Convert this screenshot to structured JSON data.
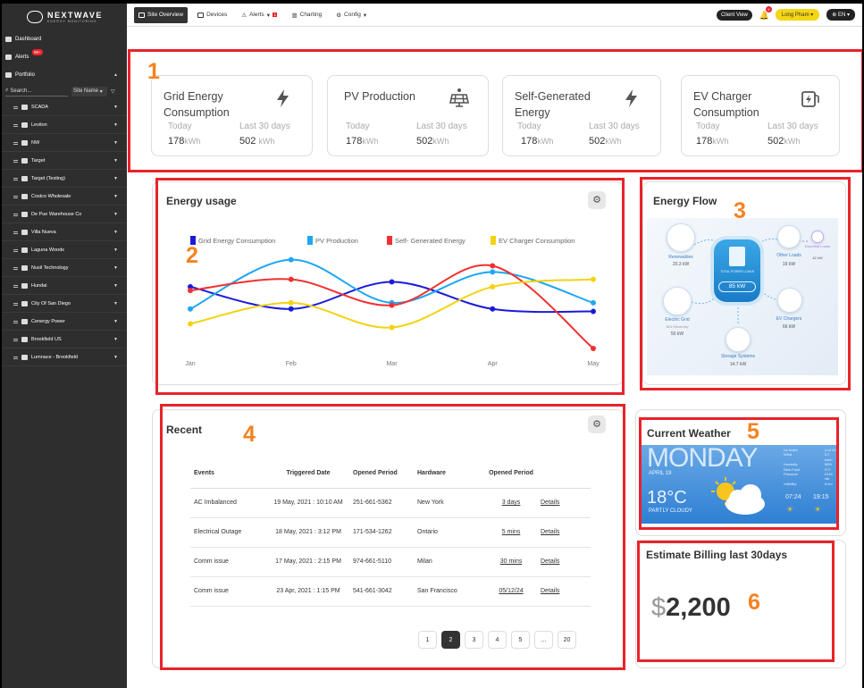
{
  "brand": {
    "name": "NEXTWAVE",
    "tagline": "ENERGY MONITORING"
  },
  "sidebar": {
    "nav": [
      {
        "label": "Dashboard",
        "icon": "dashboard-icon"
      },
      {
        "label": "Alerts",
        "badge": "99+",
        "icon": "alert-icon"
      },
      {
        "label": "Portfolio",
        "icon": "portfolio-icon"
      }
    ],
    "search_placeholder": "Search...",
    "sort_label": "Site Name",
    "sites": [
      "SCADA",
      "Leviton",
      "NW",
      "Target",
      "Target (Testing)",
      "Costco Wholesale",
      "De Pue Warehouse Co",
      "Villa Nueva",
      "Laguna Woods",
      "Nusil Technology",
      "Hundai",
      "City Of San Diego",
      "Cenergy Power",
      "Brookfield US",
      "Lumnace - Brookfield"
    ]
  },
  "topbar": {
    "tabs": [
      {
        "label": "Site Overview"
      },
      {
        "label": "Devices"
      },
      {
        "label": "Alerts",
        "badge": "1"
      },
      {
        "label": "Charting"
      },
      {
        "label": "Config"
      }
    ],
    "client_view": "Client View",
    "bell_badge": "5",
    "user": "Long Pham",
    "language": "EN"
  },
  "stats": [
    {
      "title": "Grid Energy Consumption",
      "icon": "lightning-icon",
      "today_label": "Today",
      "today": "178",
      "last_label": "Last 30 days",
      "last": "502",
      "unit": "kWh"
    },
    {
      "title": "PV Production",
      "icon": "solar-panel-icon",
      "today_label": "Today",
      "today": "178",
      "last_label": "Last 30 days",
      "last": "502",
      "unit": "kWh"
    },
    {
      "title": "Self-Generated Energy",
      "icon": "lightning-icon",
      "today_label": "Today",
      "today": "178",
      "last_label": "Last 30 days",
      "last": "502",
      "unit": "kWh"
    },
    {
      "title": "EV Charger Consumption",
      "icon": "ev-charger-icon",
      "today_label": "Today",
      "today": "178",
      "last_label": "Last 30 days",
      "last": "502",
      "unit": "kWh"
    }
  ],
  "energy_usage": {
    "title": "Energy usage"
  },
  "chart_data": {
    "type": "line",
    "x": [
      "Jan",
      "Feb",
      "Mar",
      "Apr",
      "May"
    ],
    "series": [
      {
        "name": "Grid Energy Consumption",
        "color": "#1a1adb",
        "values": [
          58,
          40,
          62,
          40,
          38
        ]
      },
      {
        "name": "PV Production",
        "color": "#1ea7f2",
        "values": [
          40,
          80,
          45,
          70,
          45
        ]
      },
      {
        "name": "Self- Generated Energy",
        "color": "#f23030",
        "values": [
          55,
          64,
          43,
          75,
          8
        ]
      },
      {
        "name": "EV Charger Consumption",
        "color": "#f5d211",
        "values": [
          28,
          45,
          25,
          58,
          64
        ]
      }
    ],
    "ylim": [
      0,
      100
    ],
    "legend": "top"
  },
  "energy_flow": {
    "title": "Energy Flow",
    "center": {
      "label": "TOTAL POWER LOADS",
      "value": "85 kW"
    },
    "nodes": [
      {
        "label": "Renewables",
        "value": "20.3 kW"
      },
      {
        "label": "Other Loads",
        "value": "19 kW"
      },
      {
        "label": "Electric Grid",
        "sub": "BDI Electricity",
        "value": "50 kW"
      },
      {
        "label": "EV Chargers",
        "value": "66 kW"
      },
      {
        "label": "Storage Systems",
        "value": "14.7 kW"
      },
      {
        "label": "Essential Loads",
        "value": "42 kW"
      }
    ]
  },
  "recent": {
    "title": "Recent",
    "columns": [
      "Events",
      "Triggered Date",
      "Opened Period",
      "Hardware",
      "Opened Period"
    ],
    "rows": [
      {
        "event": "AC Imbalanced",
        "date": "19 May, 2021 : 10:10 AM",
        "period": "251-661-5362",
        "hardware": "New York",
        "opened": "3 days",
        "action": "Details"
      },
      {
        "event": "Electrical Outage",
        "date": "18 May, 2021 : 3:12 PM",
        "period": "171-534-1262",
        "hardware": "Ontario",
        "opened": "5 mins",
        "action": "Details"
      },
      {
        "event": "Comm issue",
        "date": "17 May, 2021 : 2:15 PM",
        "period": "974-661-5110",
        "hardware": "Milan",
        "opened": "30 mins",
        "action": "Details"
      },
      {
        "event": "Comm issue",
        "date": "23 Apr, 2021 : 1:15 PM",
        "period": "541-661-3042",
        "hardware": "San Francisco",
        "opened": "05/12/24",
        "action": "Details"
      }
    ],
    "pages": [
      "1",
      "2",
      "3",
      "4",
      "5",
      "...",
      "20"
    ],
    "active_page": "2"
  },
  "weather": {
    "title": "Current Weather",
    "day": "MONDAY",
    "date": "APRIL 19",
    "temp": "18°C",
    "condition": "PARTLY CLOUDY",
    "sunrise": "07:24",
    "sunset": "19:15",
    "details": [
      [
        "Uv Index",
        "4 of 10"
      ],
      [
        "Wind",
        "3.7 km/h"
      ],
      [
        "Humidity",
        "58%"
      ],
      [
        "Dew Point",
        "9°C"
      ],
      [
        "Pressure",
        "1016 mb"
      ],
      [
        "Visibility",
        "8 km"
      ]
    ]
  },
  "billing": {
    "title": "Estimate Billing last 30days",
    "currency": "$",
    "amount": "2,200"
  },
  "annotations": [
    "1",
    "2",
    "3",
    "4",
    "5",
    "6"
  ]
}
